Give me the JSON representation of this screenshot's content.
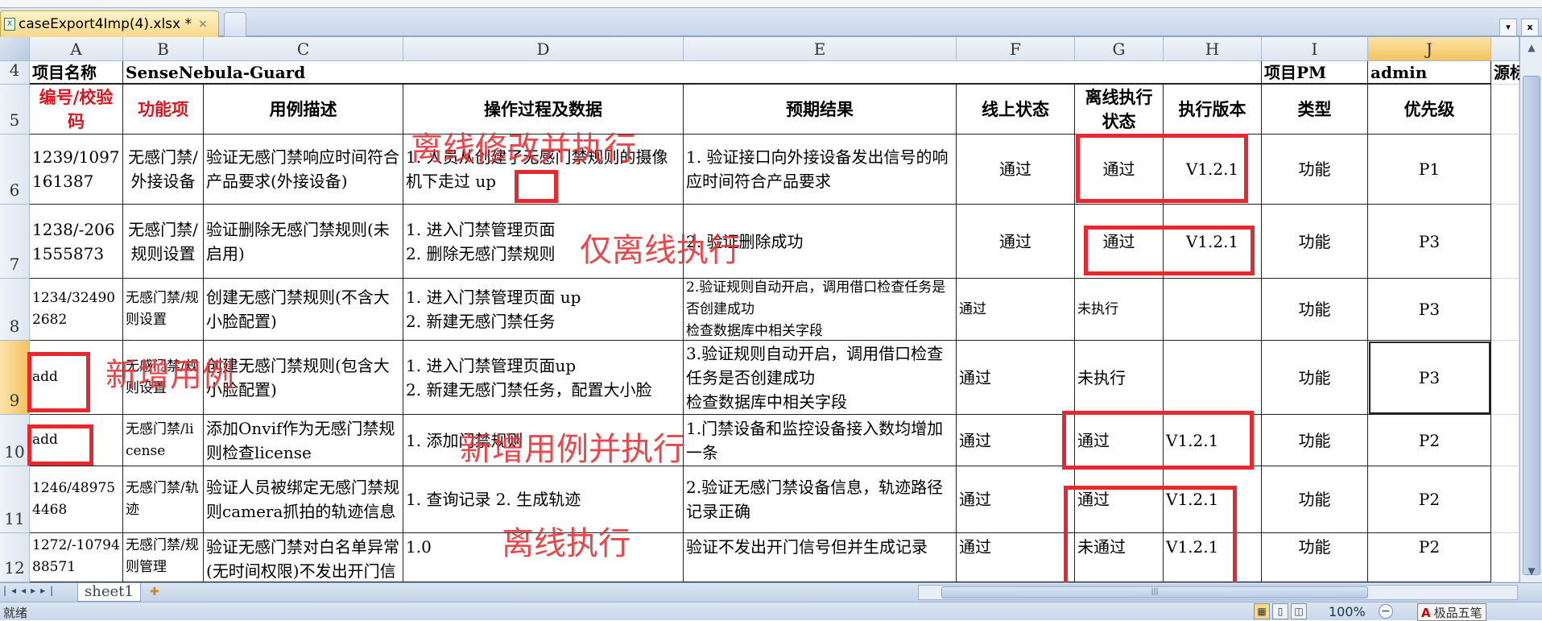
{
  "window": {
    "file_tab": "caseExport4Imp(4).xlsx *",
    "close_glyph": "×",
    "dropdown_glyph": "▾",
    "close_window_glyph": "x"
  },
  "column_headers": [
    "A",
    "B",
    "C",
    "D",
    "E",
    "F",
    "G",
    "H",
    "I",
    "J",
    ""
  ],
  "selected_column": "J",
  "selected_row": "9",
  "rows": [
    {
      "num": "4",
      "cells": [
        "项目名称",
        "SenseNebula-Guard",
        "",
        "",
        "",
        "",
        "",
        "",
        "项目PM",
        "admin",
        "源标"
      ]
    },
    {
      "num": "5",
      "cells": [
        "编号/校验码",
        "功能项",
        "用例描述",
        "操作过程及数据",
        "预期结果",
        "线上状态",
        "离线执行状态",
        "执行版本",
        "类型",
        "优先级",
        ""
      ]
    },
    {
      "num": "6",
      "cells": [
        "1239/1097161387",
        "无感门禁/外接设备",
        "验证无感门禁响应时间符合产品要求(外接设备)",
        "1. 人员从创建了无感门禁规则的摄像机下走过 up",
        "1. 验证接口向外接设备发出信号的响应时间符合产品要求",
        "通过",
        "通过",
        "V1.2.1",
        "功能",
        "P1",
        ""
      ]
    },
    {
      "num": "7",
      "cells": [
        "1238/-2061555873",
        "无感门禁/规则设置",
        "验证删除无感门禁规则(未启用)",
        "1. 进入门禁管理页面\n2. 删除无感门禁规则",
        "2. 验证删除成功",
        "通过",
        "通过",
        "V1.2.1",
        "功能",
        "P3",
        ""
      ]
    },
    {
      "num": "8",
      "cells": [
        "1234/324902682",
        "无感门禁/规则设置",
        "创建无感门禁规则(不含大小脸配置)",
        "1. 进入门禁管理页面    up\n2. 新建无感门禁任务",
        "2.验证规则自动开启，调用借口检查任务是否创建成功\n  检查数据库中相关字段",
        "通过",
        "未执行",
        "",
        "功能",
        "P3",
        ""
      ]
    },
    {
      "num": "9",
      "cells": [
        "add",
        "无感门禁/规则设置",
        "创建无感门禁规则(包含大小脸配置)",
        "1. 进入门禁管理页面up\n2. 新建无感门禁任务，配置大小脸",
        "3.验证规则自动开启，调用借口检查任务是否创建成功\n  检查数据库中相关字段",
        "通过",
        "未执行",
        "",
        "功能",
        "P3",
        ""
      ]
    },
    {
      "num": "10",
      "cells": [
        "add",
        "无感门禁/license",
        "添加Onvif作为无感门禁规则检查license",
        "1. 添加门禁规则",
        "1.门禁设备和监控设备接入数均增加一条",
        "通过",
        "通过",
        "V1.2.1",
        "功能",
        "P2",
        ""
      ]
    },
    {
      "num": "11",
      "cells": [
        "1246/489754468",
        "无感门禁/轨迹",
        "验证人员被绑定无感门禁规则camera抓拍的轨迹信息",
        "1. 查询记录 2. 生成轨迹",
        "2.验证无感门禁设备信息，轨迹路径记录正确",
        "通过",
        "通过",
        "V1.2.1",
        "功能",
        "P2",
        ""
      ]
    },
    {
      "num": "12",
      "cells": [
        "1272/-1079488571",
        "无感门禁/规则管理",
        "验证无感门禁对白名单异常(无时间权限)不发出开门信号",
        "1.0",
        "验证不发出开门信号但并生成记录",
        "通过",
        "未通过",
        "V1.2.1",
        "功能",
        "P2",
        ""
      ]
    }
  ],
  "annotations": {
    "offline_modify_execute": "离线修改并执行",
    "offline_only": "仅离线执行",
    "new_case": "新增用例",
    "new_case_execute": "新增用例并执行",
    "offline_execute": "离线执行"
  },
  "sheet_tabs": [
    "sheet1"
  ],
  "status_bar": {
    "status": "就绪",
    "zoom": "100%",
    "ime": "极品五笔"
  },
  "colors": {
    "annotation_red": "#e8282e",
    "header_red": "#e0141e",
    "selection_orange": "#f3c35e"
  }
}
